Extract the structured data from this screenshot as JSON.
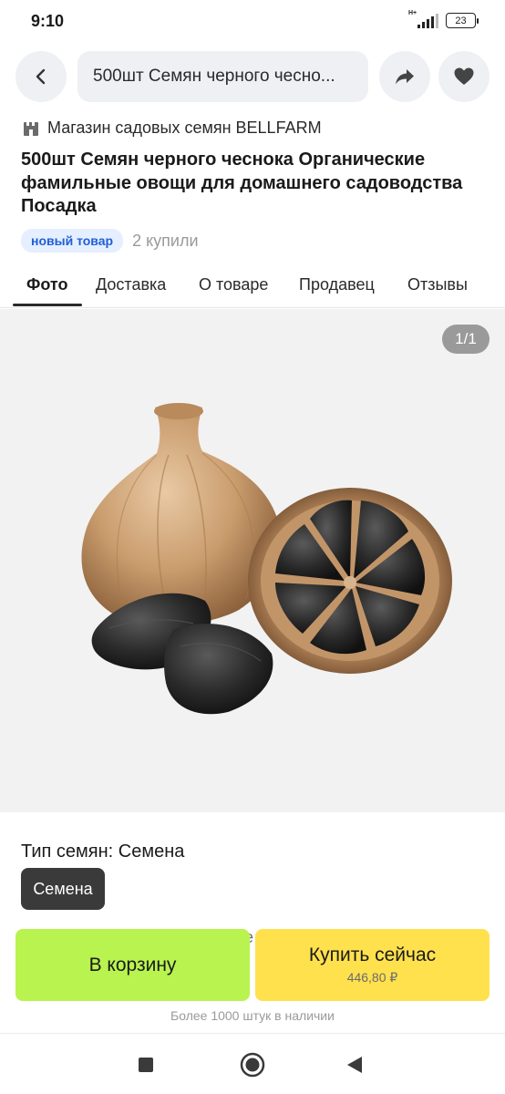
{
  "status_bar": {
    "time": "9:10",
    "network": "H+",
    "battery": "23"
  },
  "header": {
    "search_text": "500шт Семян черного чесно...",
    "icons": [
      "chevron-left-icon",
      "share-icon",
      "heart-icon"
    ]
  },
  "store": {
    "icon": "store-icon",
    "name": "Магазин садовых семян BELLFARM"
  },
  "product": {
    "title": "500шт Семян черного чеснока Органические фамильные овощи для домашнего садоводства Посадка",
    "badge": "новый товар",
    "bought": "2 купили"
  },
  "tabs": [
    {
      "label": "Фото",
      "active": true
    },
    {
      "label": "Доставка",
      "active": false
    },
    {
      "label": "О товаре",
      "active": false
    },
    {
      "label": "Продавец",
      "active": false
    },
    {
      "label": "Отзывы",
      "active": false
    }
  ],
  "gallery": {
    "counter": "1/1"
  },
  "variant": {
    "label": "Тип семян: Семена",
    "selected": "Семена"
  },
  "obscured_text": "е",
  "actions": {
    "cart_label": "В корзину",
    "buy_label": "Купить сейчас",
    "buy_price": "446,80 ₽",
    "stock": "Более 1000 штук в наличии"
  },
  "nav": {
    "icons": [
      "square-recents-icon",
      "circle-home-icon",
      "triangle-back-icon"
    ]
  },
  "colors": {
    "cart_button": "#b9f34f",
    "buy_button": "#ffe14e",
    "badge_bg": "#e6efff",
    "badge_text": "#1f5fd6"
  }
}
